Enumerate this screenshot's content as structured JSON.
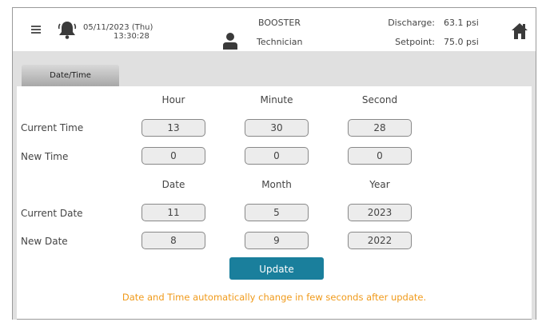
{
  "header": {
    "date": "05/11/2023 (Thu)",
    "time": "13:30:28",
    "system": "BOOSTER",
    "role": "Technician",
    "discharge_label": "Discharge:",
    "discharge_value": "63.1 psi",
    "setpoint_label": "Setpoint:",
    "setpoint_value": "75.0 psi",
    "icons": [
      "menu-icon",
      "bell-icon",
      "user-icon",
      "home-icon"
    ]
  },
  "tabs": [
    {
      "label": "Date/Time"
    }
  ],
  "time_section": {
    "columns": [
      "Hour",
      "Minute",
      "Second"
    ],
    "rows": [
      {
        "label": "Current Time",
        "values": [
          "13",
          "30",
          "28"
        ]
      },
      {
        "label": "New Time",
        "values": [
          "0",
          "0",
          "0"
        ]
      }
    ]
  },
  "date_section": {
    "columns": [
      "Date",
      "Month",
      "Year"
    ],
    "rows": [
      {
        "label": "Current Date",
        "values": [
          "11",
          "5",
          "2023"
        ]
      },
      {
        "label": "New Date",
        "values": [
          "8",
          "9",
          "2022"
        ]
      }
    ]
  },
  "update_label": "Update",
  "note": "Date and Time automatically change in few seconds after update.",
  "colors": {
    "accent": "#1a7f9c",
    "note": "#f09a1a"
  }
}
